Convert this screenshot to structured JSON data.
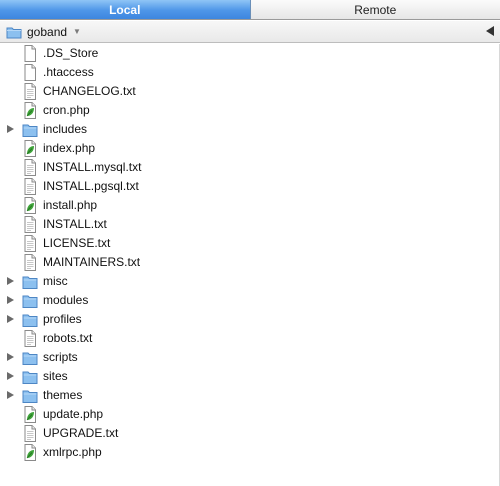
{
  "tabs": {
    "local": "Local",
    "remote": "Remote"
  },
  "path": {
    "current": "goband"
  },
  "files": [
    {
      "name": ".DS_Store",
      "kind": "file",
      "icon": "document-icon"
    },
    {
      "name": ".htaccess",
      "kind": "file",
      "icon": "document-icon"
    },
    {
      "name": "CHANGELOG.txt",
      "kind": "text",
      "icon": "text-document-icon"
    },
    {
      "name": "cron.php",
      "kind": "php",
      "icon": "php-leaf-icon"
    },
    {
      "name": "includes",
      "kind": "folder",
      "icon": "folder-icon"
    },
    {
      "name": "index.php",
      "kind": "php",
      "icon": "php-leaf-icon"
    },
    {
      "name": "INSTALL.mysql.txt",
      "kind": "text",
      "icon": "text-document-icon"
    },
    {
      "name": "INSTALL.pgsql.txt",
      "kind": "text",
      "icon": "text-document-icon"
    },
    {
      "name": "install.php",
      "kind": "php",
      "icon": "php-leaf-icon"
    },
    {
      "name": "INSTALL.txt",
      "kind": "text",
      "icon": "text-document-icon"
    },
    {
      "name": "LICENSE.txt",
      "kind": "text",
      "icon": "text-document-icon"
    },
    {
      "name": "MAINTAINERS.txt",
      "kind": "text",
      "icon": "text-document-icon"
    },
    {
      "name": "misc",
      "kind": "folder",
      "icon": "folder-icon"
    },
    {
      "name": "modules",
      "kind": "folder",
      "icon": "folder-icon"
    },
    {
      "name": "profiles",
      "kind": "folder",
      "icon": "folder-icon"
    },
    {
      "name": "robots.txt",
      "kind": "text",
      "icon": "text-document-icon"
    },
    {
      "name": "scripts",
      "kind": "folder",
      "icon": "folder-icon"
    },
    {
      "name": "sites",
      "kind": "folder",
      "icon": "folder-icon"
    },
    {
      "name": "themes",
      "kind": "folder",
      "icon": "folder-icon"
    },
    {
      "name": "update.php",
      "kind": "php",
      "icon": "php-leaf-icon"
    },
    {
      "name": "UPGRADE.txt",
      "kind": "text",
      "icon": "text-document-icon"
    },
    {
      "name": "xmlrpc.php",
      "kind": "php",
      "icon": "php-leaf-icon"
    }
  ],
  "colors": {
    "selected_tab": "#4e96e8",
    "folder_blue": "#7fb7ec",
    "php_leaf": "#3fa33a"
  }
}
